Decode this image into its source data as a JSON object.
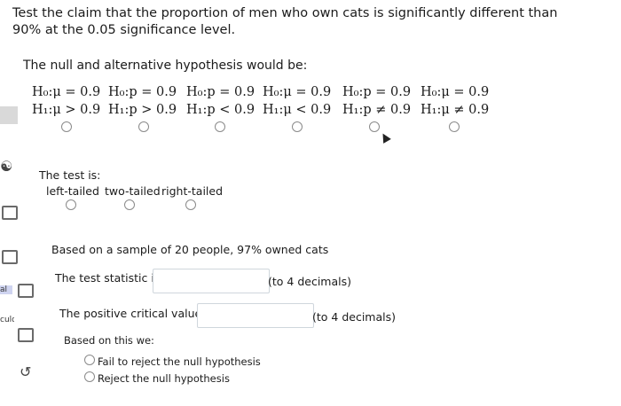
{
  "question": {
    "prompt": "Test the claim that the proportion of men who own cats is significantly different than 90% at the 0.05 significance level."
  },
  "hypotheses": {
    "heading": "The null and alternative hypothesis would be:",
    "options": [
      {
        "h0": "H₀:μ = 0.9",
        "h1": "H₁:μ > 0.9"
      },
      {
        "h0": "H₀:p = 0.9",
        "h1": "H₁:p > 0.9"
      },
      {
        "h0": "H₀:p = 0.9",
        "h1": "H₁:p < 0.9"
      },
      {
        "h0": "H₀:μ = 0.9",
        "h1": "H₁:μ < 0.9"
      },
      {
        "h0": "H₀:p = 0.9",
        "h1": "H₁:p ≠ 0.9"
      },
      {
        "h0": "H₀:μ = 0.9",
        "h1": "H₁:μ ≠ 0.9"
      }
    ]
  },
  "test_type": {
    "heading": "The test is:",
    "options": [
      "left-tailed",
      "two-tailed",
      "right-tailed"
    ]
  },
  "sample": {
    "text": "Based on a sample of 20 people, 97% owned cats"
  },
  "statistic": {
    "label": "The test statistic is:",
    "value": "",
    "hint": "(to 4 decimals)"
  },
  "critical": {
    "label": "The positive critical value is:",
    "value": "",
    "hint": "(to 4 decimals)"
  },
  "conclusion": {
    "heading": "Based on this we:",
    "options": [
      "Fail to reject the null hypothesis",
      "Reject the null hypothesis"
    ]
  },
  "sidebar": {
    "fragments": [
      "al",
      "culd"
    ]
  }
}
